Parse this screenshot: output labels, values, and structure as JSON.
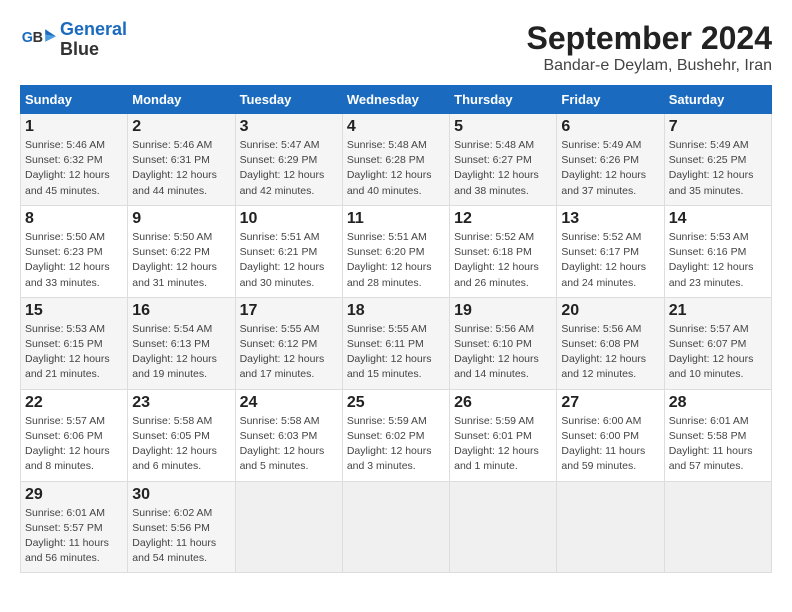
{
  "logo": {
    "line1": "General",
    "line2": "Blue"
  },
  "title": "September 2024",
  "subtitle": "Bandar-e Deylam, Bushehr, Iran",
  "days_of_week": [
    "Sunday",
    "Monday",
    "Tuesday",
    "Wednesday",
    "Thursday",
    "Friday",
    "Saturday"
  ],
  "weeks": [
    [
      {
        "day": "1",
        "sunrise": "5:46 AM",
        "sunset": "6:32 PM",
        "daylight": "12 hours and 45 minutes."
      },
      {
        "day": "2",
        "sunrise": "5:46 AM",
        "sunset": "6:31 PM",
        "daylight": "12 hours and 44 minutes."
      },
      {
        "day": "3",
        "sunrise": "5:47 AM",
        "sunset": "6:29 PM",
        "daylight": "12 hours and 42 minutes."
      },
      {
        "day": "4",
        "sunrise": "5:48 AM",
        "sunset": "6:28 PM",
        "daylight": "12 hours and 40 minutes."
      },
      {
        "day": "5",
        "sunrise": "5:48 AM",
        "sunset": "6:27 PM",
        "daylight": "12 hours and 38 minutes."
      },
      {
        "day": "6",
        "sunrise": "5:49 AM",
        "sunset": "6:26 PM",
        "daylight": "12 hours and 37 minutes."
      },
      {
        "day": "7",
        "sunrise": "5:49 AM",
        "sunset": "6:25 PM",
        "daylight": "12 hours and 35 minutes."
      }
    ],
    [
      {
        "day": "8",
        "sunrise": "5:50 AM",
        "sunset": "6:23 PM",
        "daylight": "12 hours and 33 minutes."
      },
      {
        "day": "9",
        "sunrise": "5:50 AM",
        "sunset": "6:22 PM",
        "daylight": "12 hours and 31 minutes."
      },
      {
        "day": "10",
        "sunrise": "5:51 AM",
        "sunset": "6:21 PM",
        "daylight": "12 hours and 30 minutes."
      },
      {
        "day": "11",
        "sunrise": "5:51 AM",
        "sunset": "6:20 PM",
        "daylight": "12 hours and 28 minutes."
      },
      {
        "day": "12",
        "sunrise": "5:52 AM",
        "sunset": "6:18 PM",
        "daylight": "12 hours and 26 minutes."
      },
      {
        "day": "13",
        "sunrise": "5:52 AM",
        "sunset": "6:17 PM",
        "daylight": "12 hours and 24 minutes."
      },
      {
        "day": "14",
        "sunrise": "5:53 AM",
        "sunset": "6:16 PM",
        "daylight": "12 hours and 23 minutes."
      }
    ],
    [
      {
        "day": "15",
        "sunrise": "5:53 AM",
        "sunset": "6:15 PM",
        "daylight": "12 hours and 21 minutes."
      },
      {
        "day": "16",
        "sunrise": "5:54 AM",
        "sunset": "6:13 PM",
        "daylight": "12 hours and 19 minutes."
      },
      {
        "day": "17",
        "sunrise": "5:55 AM",
        "sunset": "6:12 PM",
        "daylight": "12 hours and 17 minutes."
      },
      {
        "day": "18",
        "sunrise": "5:55 AM",
        "sunset": "6:11 PM",
        "daylight": "12 hours and 15 minutes."
      },
      {
        "day": "19",
        "sunrise": "5:56 AM",
        "sunset": "6:10 PM",
        "daylight": "12 hours and 14 minutes."
      },
      {
        "day": "20",
        "sunrise": "5:56 AM",
        "sunset": "6:08 PM",
        "daylight": "12 hours and 12 minutes."
      },
      {
        "day": "21",
        "sunrise": "5:57 AM",
        "sunset": "6:07 PM",
        "daylight": "12 hours and 10 minutes."
      }
    ],
    [
      {
        "day": "22",
        "sunrise": "5:57 AM",
        "sunset": "6:06 PM",
        "daylight": "12 hours and 8 minutes."
      },
      {
        "day": "23",
        "sunrise": "5:58 AM",
        "sunset": "6:05 PM",
        "daylight": "12 hours and 6 minutes."
      },
      {
        "day": "24",
        "sunrise": "5:58 AM",
        "sunset": "6:03 PM",
        "daylight": "12 hours and 5 minutes."
      },
      {
        "day": "25",
        "sunrise": "5:59 AM",
        "sunset": "6:02 PM",
        "daylight": "12 hours and 3 minutes."
      },
      {
        "day": "26",
        "sunrise": "5:59 AM",
        "sunset": "6:01 PM",
        "daylight": "12 hours and 1 minute."
      },
      {
        "day": "27",
        "sunrise": "6:00 AM",
        "sunset": "6:00 PM",
        "daylight": "11 hours and 59 minutes."
      },
      {
        "day": "28",
        "sunrise": "6:01 AM",
        "sunset": "5:58 PM",
        "daylight": "11 hours and 57 minutes."
      }
    ],
    [
      {
        "day": "29",
        "sunrise": "6:01 AM",
        "sunset": "5:57 PM",
        "daylight": "11 hours and 56 minutes."
      },
      {
        "day": "30",
        "sunrise": "6:02 AM",
        "sunset": "5:56 PM",
        "daylight": "11 hours and 54 minutes."
      },
      null,
      null,
      null,
      null,
      null
    ]
  ]
}
